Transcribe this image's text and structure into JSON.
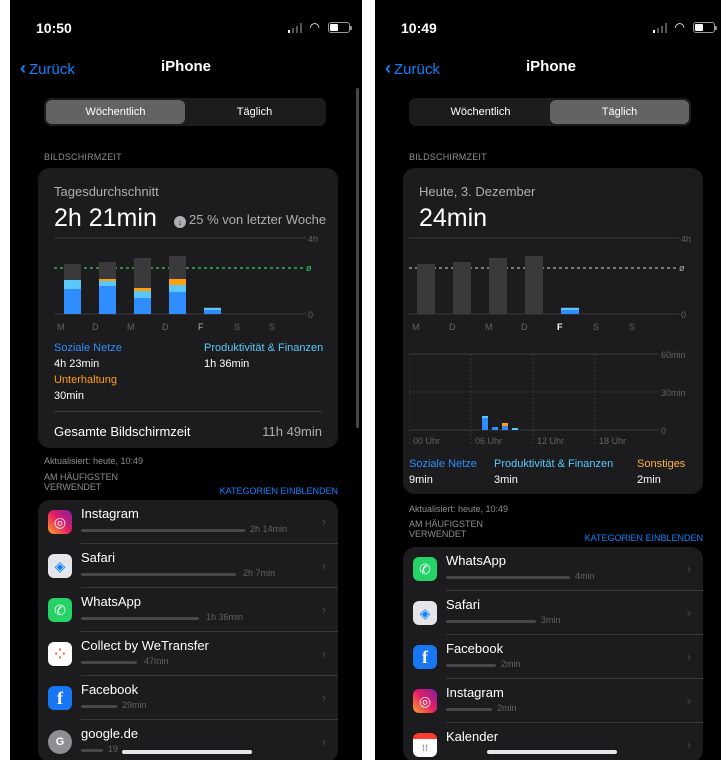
{
  "colors": {
    "blue": "#0a84ff",
    "social": "#2f8dff",
    "productivity": "#5ac8fa",
    "entertainment": "#ff9f0a",
    "other": "#ffb340",
    "green": "#30d158"
  },
  "left": {
    "status_time": "10:50",
    "nav": {
      "back": "Zurück",
      "title": "iPhone"
    },
    "segment": {
      "weekly": "Wöchentlich",
      "daily": "Täglich",
      "selected": "weekly"
    },
    "screen_time_label": "BILDSCHIRMZEIT",
    "card": {
      "subtitle": "Tagesdurchschnitt",
      "total": "2h 21min",
      "delta": "25 % von letzter Woche",
      "chart": {
        "y_max_label": "4h",
        "y_min_label": "0",
        "avg_label": "ø",
        "days": [
          "M",
          "D",
          "M",
          "D",
          "F",
          "S",
          "S"
        ]
      },
      "legend": [
        {
          "name": "Soziale Netze",
          "value": "4h 23min"
        },
        {
          "name": "Produktivität & Finanzen",
          "value": "1h 36min"
        },
        {
          "name": "Unterhaltung",
          "value": "30min"
        }
      ],
      "total_row": {
        "label": "Gesamte Bildschirmzeit",
        "value": "11h 49min"
      }
    },
    "updated": "Aktualisiert: heute, 10:49",
    "most_used": "AM HÄUFIGSTEN VERWENDET",
    "show_categories": "KATEGORIEN EINBLENDEN",
    "apps": [
      {
        "name": "Instagram",
        "duration": "2h 14min",
        "icon": "instagram-icon"
      },
      {
        "name": "Safari",
        "duration": "2h 7min",
        "icon": "safari-icon"
      },
      {
        "name": "WhatsApp",
        "duration": "1h 36min",
        "icon": "whatsapp-icon"
      },
      {
        "name": "Collect by WeTransfer",
        "duration": "47min",
        "icon": "collect-icon"
      },
      {
        "name": "Facebook",
        "duration": "29min",
        "icon": "facebook-icon"
      },
      {
        "name": "google.de",
        "duration": "19",
        "icon": "google-icon"
      }
    ]
  },
  "right": {
    "status_time": "10:49",
    "nav": {
      "back": "Zurück",
      "title": "iPhone"
    },
    "segment": {
      "weekly": "Wöchentlich",
      "daily": "Täglich",
      "selected": "daily"
    },
    "screen_time_label": "BILDSCHIRMZEIT",
    "card": {
      "subtitle": "Heute, 3. Dezember",
      "total": "24min",
      "chart": {
        "y_max_label": "4h",
        "y_min_label": "0",
        "avg_label": "ø",
        "days": [
          "M",
          "D",
          "M",
          "D",
          "F",
          "S",
          "S"
        ]
      },
      "hourly": {
        "labels": [
          "00 Uhr",
          "06 Uhr",
          "12 Uhr",
          "18 Uhr"
        ],
        "y_labels": [
          "60min",
          "30min",
          "0"
        ]
      },
      "legend": [
        {
          "name": "Soziale Netze",
          "value": "9min"
        },
        {
          "name": "Produktivität & Finanzen",
          "value": "3min"
        },
        {
          "name": "Sonstiges",
          "value": "2min"
        }
      ]
    },
    "updated": "Aktualisiert: heute, 10:49",
    "most_used": "AM HÄUFIGSTEN VERWENDET",
    "show_categories": "KATEGORIEN EINBLENDEN",
    "apps": [
      {
        "name": "WhatsApp",
        "duration": "4min",
        "icon": "whatsapp-icon"
      },
      {
        "name": "Safari",
        "duration": "3min",
        "icon": "safari-icon"
      },
      {
        "name": "Facebook",
        "duration": "2min",
        "icon": "facebook-icon"
      },
      {
        "name": "Instagram",
        "duration": "2min",
        "icon": "instagram-icon"
      },
      {
        "name": "Kalender",
        "duration": "",
        "icon": "calendar-icon"
      }
    ]
  }
}
